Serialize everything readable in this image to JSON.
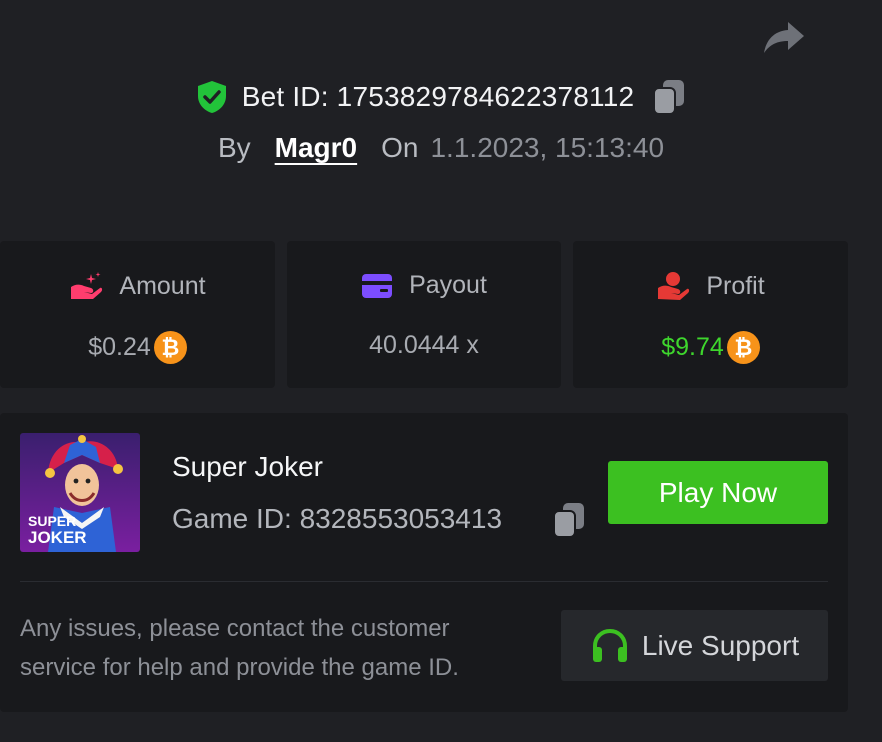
{
  "header": {
    "bet_id_label": "Bet ID: 1753829784622378112",
    "by_label": "By",
    "username": "Magr0",
    "on_label": "On",
    "datetime": "1.1.2023, 15:13:40"
  },
  "stats": {
    "amount": {
      "label": "Amount",
      "value": "$0.24",
      "currency_icon": "bitcoin-icon"
    },
    "payout": {
      "label": "Payout",
      "value": "40.0444 x"
    },
    "profit": {
      "label": "Profit",
      "value": "$9.74",
      "currency_icon": "bitcoin-icon"
    }
  },
  "game": {
    "name": "Super Joker",
    "game_id_label": "Game ID: 8328553053413",
    "thumbnail_text_1": "SUPER",
    "thumbnail_text_2": "JOKER",
    "play_label": "Play Now"
  },
  "support": {
    "help_text": "Any issues, please contact the customer service for help and provide the game ID.",
    "button_label": "Live Support"
  },
  "icons": {
    "share": "share-icon",
    "verified": "shield-check-icon",
    "copy": "copy-icon",
    "amount": "hand-sparkle-icon",
    "payout": "card-icon",
    "profit": "hand-coin-icon",
    "support": "headset-icon",
    "currency": "bitcoin-icon"
  },
  "colors": {
    "background": "#1f2024",
    "card": "#18191c",
    "accent_green": "#3cc021",
    "profit_green": "#3ed62d",
    "bitcoin_orange": "#f7931a",
    "payout_purple": "#7c4dff",
    "amount_pink": "#ff3d6e",
    "profit_red": "#e53935"
  }
}
